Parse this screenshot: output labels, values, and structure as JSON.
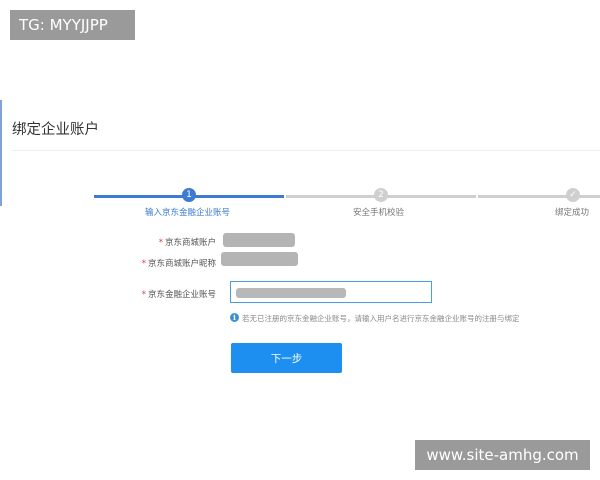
{
  "watermark_top": "TG: MYYJJPP",
  "watermark_bottom": "www.site-amhg.com",
  "page_title": "绑定企业账户",
  "steps": [
    {
      "number": "1",
      "label": "输入京东金融企业账号",
      "state": "active"
    },
    {
      "number": "2",
      "label": "安全手机校验",
      "state": "pending"
    },
    {
      "number": "✓",
      "label": "绑定成功",
      "state": "pending"
    }
  ],
  "form": {
    "required_mark": "*",
    "fields": [
      {
        "label": "京东商城账户",
        "value_masked": true
      },
      {
        "label": "京东商城账户昵称",
        "value_masked": true
      },
      {
        "label": "京东金融企业账号",
        "value_masked": true
      }
    ],
    "hint_icon": "info-icon",
    "hint": "若无已注册的京东金融企业账号，请输入用户名进行京东金融企业账号的注册与绑定",
    "next_button": "下一步"
  },
  "colors": {
    "accent": "#1c8ff0",
    "step_active": "#3d7bd0",
    "step_inactive": "#cfcfcf",
    "required": "#e4393c",
    "input_border": "#4a9fe1"
  }
}
